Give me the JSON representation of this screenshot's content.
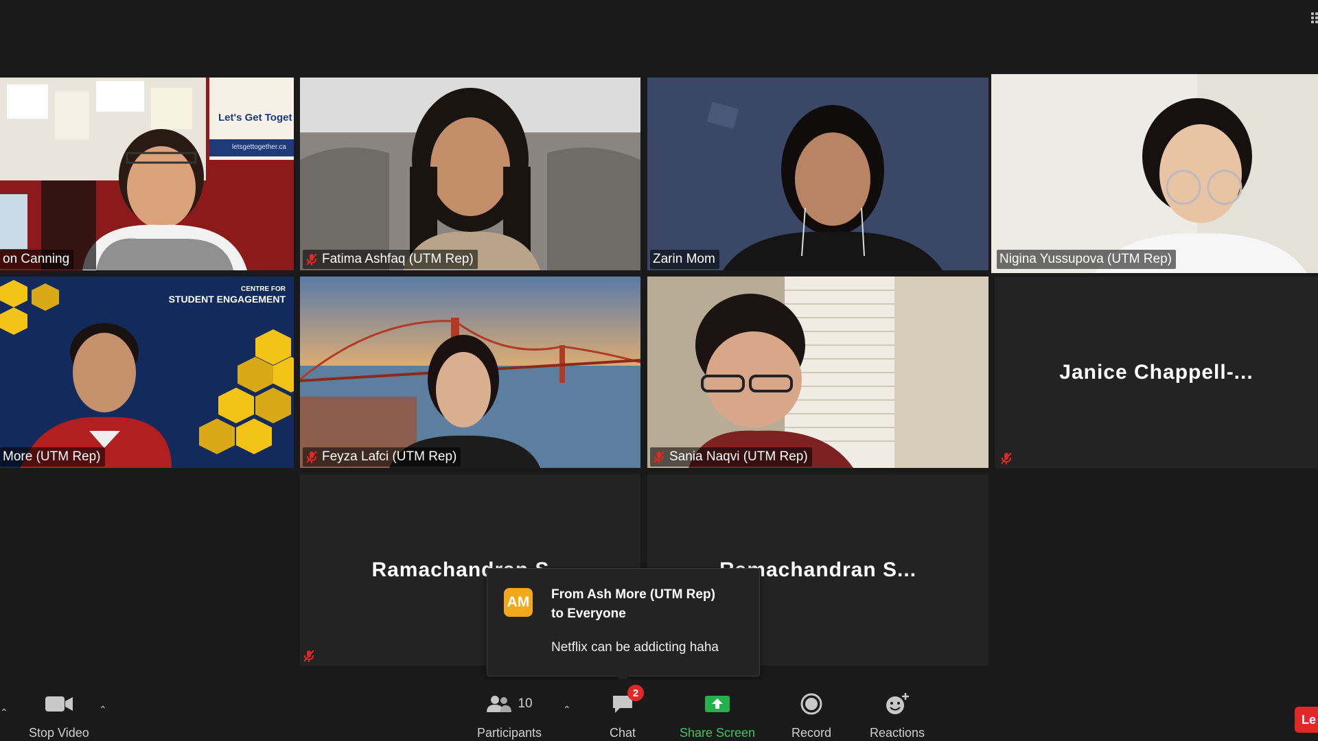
{
  "participants": {
    "tile1": {
      "name": "on Canning",
      "muted": false
    },
    "tile2": {
      "name": "Fatima Ashfaq (UTM Rep)",
      "muted": true
    },
    "tile3": {
      "name": "Zarin Mom",
      "muted": false
    },
    "tile4": {
      "name": "Nigina Yussupova (UTM Rep)",
      "muted": false,
      "active_speaker": true
    },
    "tile5": {
      "name": "More (UTM Rep)",
      "muted": false,
      "bg_text_line1": "CENTRE FOR",
      "bg_text_line2": "STUDENT ENGAGEMENT"
    },
    "tile6": {
      "name": "Feyza Lafci (UTM Rep)",
      "muted": true
    },
    "tile7": {
      "name": "Sania Naqvi (UTM Rep)",
      "muted": true
    },
    "tile8": {
      "name": "Janice Chappell-...",
      "muted": true
    },
    "tile9": {
      "name": "Ramachandran S...",
      "muted": true
    },
    "tile10": {
      "name": "Ramachandran S...",
      "muted": false
    }
  },
  "tile1_poster": {
    "line1": "Let's Get Toget",
    "line2": "letsgettogether.ca"
  },
  "chat_popup": {
    "avatar_initials": "AM",
    "avatar_color": "#f1a81b",
    "from_line1": "From Ash More (UTM Rep)",
    "from_line2": "to Everyone",
    "message": "Netflix can be addicting haha"
  },
  "toolbar": {
    "stop_video": "Stop Video",
    "participants": "Participants",
    "participants_count": "10",
    "chat": "Chat",
    "chat_badge": "2",
    "share_screen": "Share Screen",
    "record": "Record",
    "reactions": "Reactions",
    "leave_partial": "Le"
  },
  "colors": {
    "active_speaker_border": "#c8e34a",
    "share_green": "#22b14c",
    "badge_red": "#e02828"
  },
  "icons": [
    "video-camera-icon",
    "participants-icon",
    "chat-bubble-icon",
    "share-screen-icon",
    "record-icon",
    "reactions-icon",
    "mic-muted-icon",
    "grid-view-icon"
  ]
}
